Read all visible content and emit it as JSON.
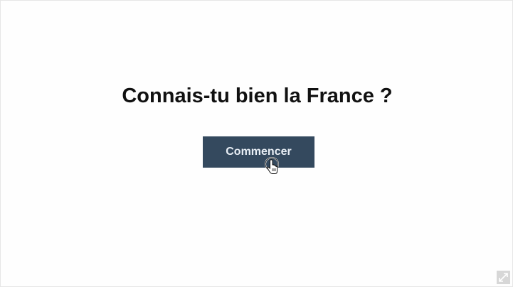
{
  "quiz": {
    "title": "Connais-tu bien la France ?",
    "start_label": "Commencer"
  },
  "icons": {
    "cursor": "hand-pointer-icon",
    "expand": "expand-icon"
  },
  "colors": {
    "button_bg": "#34495e",
    "button_text": "#e8eef5",
    "title_text": "#111111",
    "background": "#ffffff"
  }
}
